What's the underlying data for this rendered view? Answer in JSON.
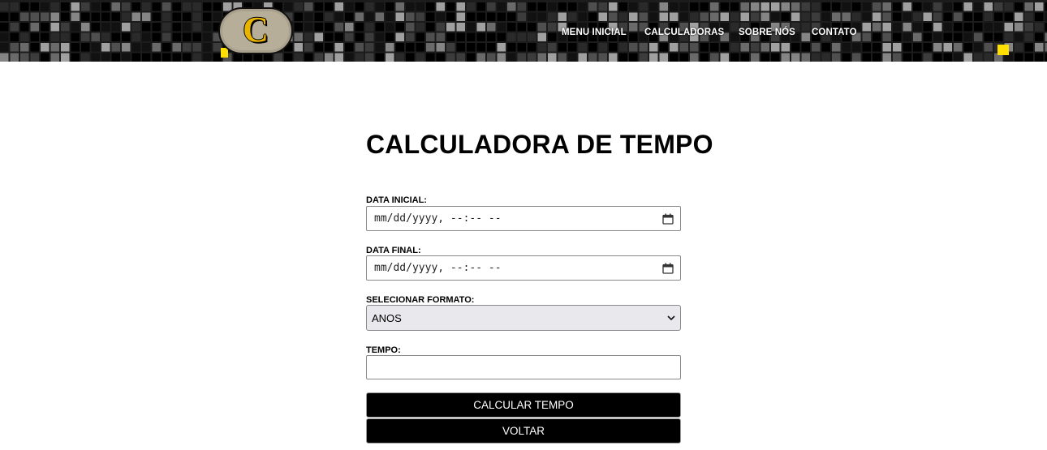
{
  "header": {
    "logo_letter": "C",
    "nav": [
      {
        "label": "MENU INICIAL"
      },
      {
        "label": "CALCULADORAS"
      },
      {
        "label": "SOBRE NÓS"
      },
      {
        "label": "CONTATO"
      }
    ]
  },
  "main": {
    "title": "CALCULADORA DE TEMPO",
    "start_date": {
      "label": "DATA INICIAL:",
      "placeholder": "mm/dd/yyyy, --:-- --"
    },
    "end_date": {
      "label": "DATA FINAL:",
      "placeholder": "mm/dd/yyyy, --:-- --"
    },
    "format": {
      "label": "SELECIONAR FORMATO:",
      "selected": "ANOS"
    },
    "time": {
      "label": "TEMPO:",
      "value": ""
    },
    "calculate_label": "CALCULAR TEMPO",
    "back_label": "VOLTAR"
  },
  "colors": {
    "header_bg": "#1c1c1c",
    "accent_yellow": "#ffe000",
    "button_bg": "#000000"
  }
}
